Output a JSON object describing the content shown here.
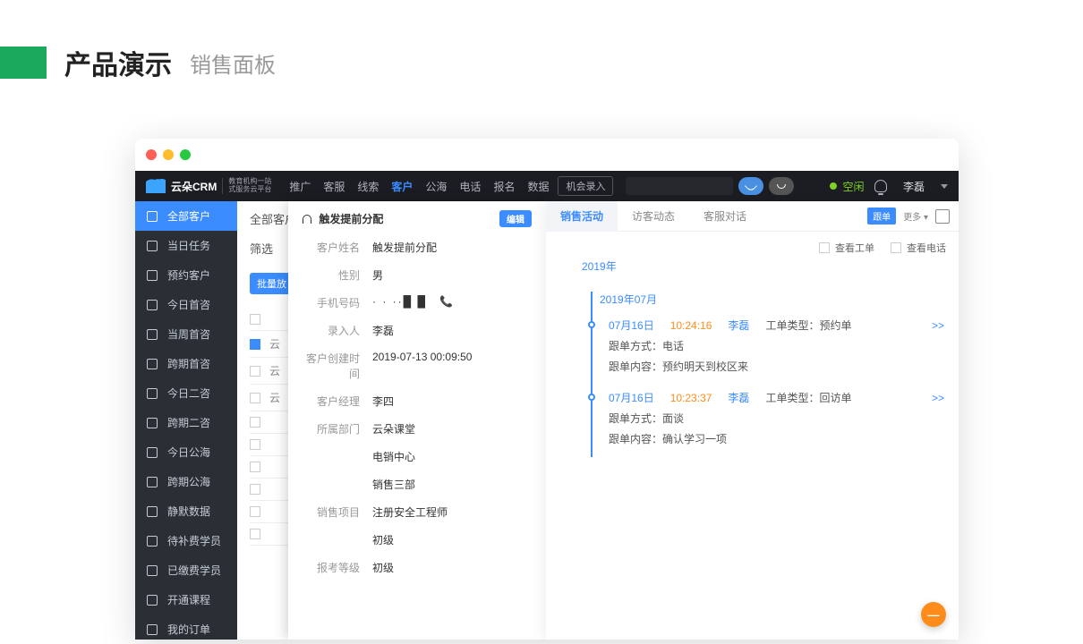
{
  "page": {
    "title": "产品演示",
    "subtitle": "销售面板"
  },
  "brand": {
    "name": "云朵CRM",
    "tagline1": "教育机构一站",
    "tagline2": "式服务云平台"
  },
  "topMenu": [
    {
      "label": "推广"
    },
    {
      "label": "客服"
    },
    {
      "label": "线索"
    },
    {
      "label": "客户",
      "active": true
    },
    {
      "label": "公海"
    },
    {
      "label": "电话"
    },
    {
      "label": "报名"
    },
    {
      "label": "数据"
    }
  ],
  "topChip": "机会录入",
  "topStatus": {
    "text": "空闲"
  },
  "topUser": {
    "name": "李磊"
  },
  "sidebar": [
    {
      "label": "全部客户",
      "active": true
    },
    {
      "label": "当日任务"
    },
    {
      "label": "预约客户"
    },
    {
      "label": "今日首咨"
    },
    {
      "label": "当周首咨"
    },
    {
      "label": "跨期首咨"
    },
    {
      "label": "今日二咨"
    },
    {
      "label": "跨期二咨"
    },
    {
      "label": "今日公海"
    },
    {
      "label": "跨期公海"
    },
    {
      "label": "静默数据"
    },
    {
      "label": "待补费学员"
    },
    {
      "label": "已缴费学员"
    },
    {
      "label": "开通课程"
    },
    {
      "label": "我的订单"
    }
  ],
  "listPanel": {
    "heading": "全部客户",
    "filterLabel": "筛选",
    "bulkBtn": "批量放",
    "rows": [
      {
        "txt": ""
      },
      {
        "txt": "云",
        "hi": true
      },
      {
        "txt": "云"
      },
      {
        "txt": "云"
      },
      {
        "txt": ""
      },
      {
        "txt": ""
      },
      {
        "txt": ""
      },
      {
        "txt": ""
      },
      {
        "txt": ""
      },
      {
        "txt": ""
      }
    ]
  },
  "detail": {
    "title": "触发提前分配",
    "editBtn": "编辑",
    "fields": [
      {
        "k": "客户姓名",
        "v": "触发提前分配"
      },
      {
        "k": "性别",
        "v": "男"
      },
      {
        "k": "手机号码",
        "v": "· · ··█  █",
        "phone": true
      },
      {
        "k": "录入人",
        "v": "李磊"
      },
      {
        "k": "客户创建时间",
        "v": "2019-07-13 00:09:50"
      },
      {
        "k": "客户经理",
        "v": "李四"
      },
      {
        "k": "所属部门",
        "v": "云朵课堂"
      },
      {
        "k": "",
        "v": "电销中心"
      },
      {
        "k": "",
        "v": "销售三部"
      },
      {
        "k": "销售项目",
        "v": "注册安全工程师"
      },
      {
        "k": "",
        "v": "初级"
      },
      {
        "k": "报考等级",
        "v": "初级"
      }
    ]
  },
  "activity": {
    "tabs": [
      {
        "label": "销售活动",
        "on": true
      },
      {
        "label": "访客动态"
      },
      {
        "label": "客服对话"
      }
    ],
    "followBtn": "跟单",
    "moreLabel": "更多 ▾",
    "filterChecks": [
      {
        "label": "查看工单"
      },
      {
        "label": "查看电话"
      }
    ],
    "year": "2019年",
    "month": "2019年07月",
    "entries": [
      {
        "date": "07月16日",
        "time": "10:24:16",
        "who": "李磊",
        "typeLabel": "工单类型：",
        "typeValue": "预约单",
        "details": [
          {
            "k": "跟单方式：",
            "v": "电话"
          },
          {
            "k": "跟单内容：",
            "v": "预约明天到校区来"
          }
        ]
      },
      {
        "date": "07月16日",
        "time": "10:23:37",
        "who": "李磊",
        "typeLabel": "工单类型：",
        "typeValue": "回访单",
        "details": [
          {
            "k": "跟单方式：",
            "v": "面谈"
          },
          {
            "k": "跟单内容：",
            "v": "确认学习一项"
          }
        ]
      }
    ],
    "moreArrow": ">>"
  },
  "fab": "—"
}
